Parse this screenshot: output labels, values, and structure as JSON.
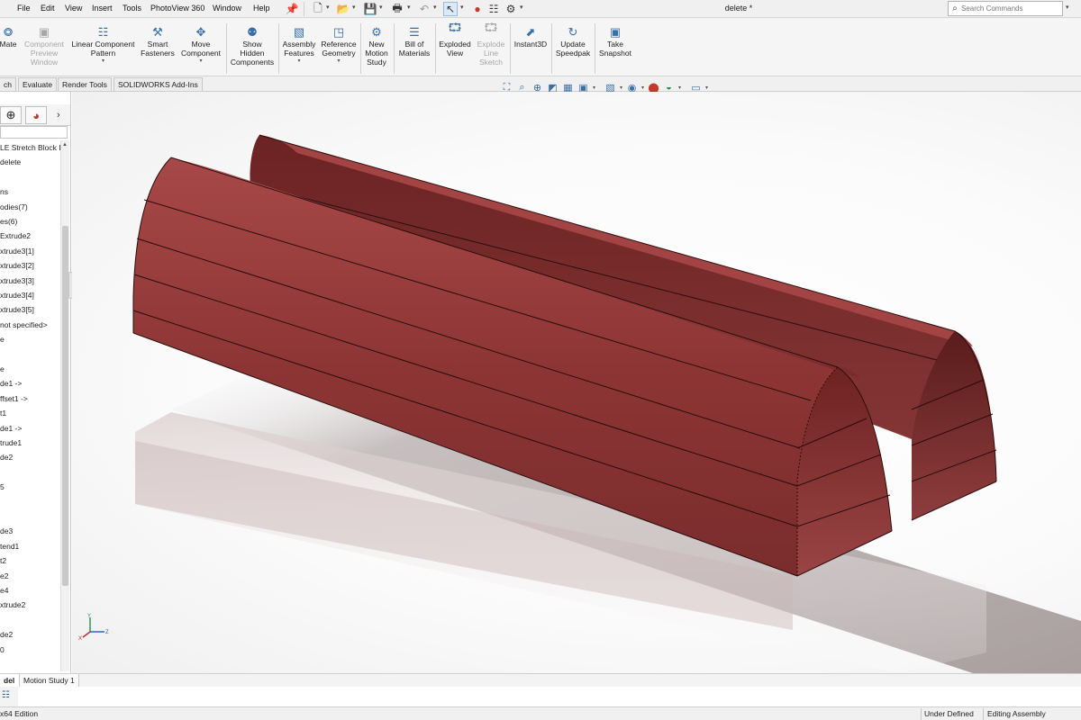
{
  "menu": {
    "items": [
      "File",
      "Edit",
      "View",
      "Insert",
      "Tools",
      "PhotoView 360",
      "Window",
      "Help"
    ],
    "pin_icon": "pin-icon"
  },
  "quick_access": {
    "icons": [
      "new-document-icon",
      "open-icon",
      "save-icon",
      "print-icon",
      "undo-icon",
      "select-arrow-icon",
      "rebuild-icon",
      "file-properties-icon",
      "options-icon"
    ]
  },
  "document": {
    "title": "delete *"
  },
  "search": {
    "placeholder": "Search Commands"
  },
  "command_manager": {
    "commands": [
      {
        "label": "Mate",
        "icon": "mate-icon",
        "enabled": true,
        "dropdown": false
      },
      {
        "label": "Component\nPreview\nWindow",
        "icon": "preview-window-icon",
        "enabled": false,
        "dropdown": false
      },
      {
        "label": "Linear Component\nPattern",
        "icon": "linear-pattern-icon",
        "enabled": true,
        "dropdown": true
      },
      {
        "label": "Smart\nFasteners",
        "icon": "smart-fasteners-icon",
        "enabled": true,
        "dropdown": false
      },
      {
        "label": "Move\nComponent",
        "icon": "move-component-icon",
        "enabled": true,
        "dropdown": true
      },
      {
        "label": "Show\nHidden\nComponents",
        "icon": "show-hidden-icon",
        "enabled": true,
        "dropdown": false
      },
      {
        "label": "Assembly\nFeatures",
        "icon": "assembly-features-icon",
        "enabled": true,
        "dropdown": true
      },
      {
        "label": "Reference\nGeometry",
        "icon": "reference-geometry-icon",
        "enabled": true,
        "dropdown": true
      },
      {
        "label": "New\nMotion\nStudy",
        "icon": "motion-study-icon",
        "enabled": true,
        "dropdown": false
      },
      {
        "label": "Bill of\nMaterials",
        "icon": "bill-of-materials-icon",
        "enabled": true,
        "dropdown": false
      },
      {
        "label": "Exploded\nView",
        "icon": "exploded-view-icon",
        "enabled": true,
        "dropdown": false
      },
      {
        "label": "Explode\nLine\nSketch",
        "icon": "explode-line-sketch-icon",
        "enabled": false,
        "dropdown": false
      },
      {
        "label": "Instant3D",
        "icon": "instant3d-icon",
        "enabled": true,
        "dropdown": false
      },
      {
        "label": "Update\nSpeedpak",
        "icon": "update-speedpak-icon",
        "enabled": true,
        "dropdown": false
      },
      {
        "label": "Take\nSnapshot",
        "icon": "take-snapshot-icon",
        "enabled": true,
        "dropdown": false
      }
    ]
  },
  "tabs": [
    "ch",
    "Evaluate",
    "Render Tools",
    "SOLIDWORKS Add-Ins"
  ],
  "view_toolbar": {
    "icons": [
      "zoom-to-fit-icon",
      "zoom-to-area-icon",
      "previous-view-icon",
      "section-view-icon",
      "dynamic-annotation-icon",
      "view-orientation-icon",
      "display-style-icon",
      "hide-show-items-icon",
      "edit-appearance-icon",
      "apply-scene-icon",
      "view-settings-icon"
    ]
  },
  "feature_tree": {
    "items": [
      "LE Stretch Block Ir",
      "delete",
      "",
      "ns",
      "odies(7)",
      "es(6)",
      "Extrude2",
      "xtrude3[1]",
      "xtrude3[2]",
      "xtrude3[3]",
      "xtrude3[4]",
      "xtrude3[5]",
      "not specified>",
      "e",
      "",
      "e",
      "de1 ->",
      "ffset1 ->",
      "t1",
      "de1 ->",
      "trude1",
      "de2",
      "",
      "5",
      "",
      "",
      "de3",
      "tend1",
      "t2",
      "e2",
      "e4",
      "xtrude2",
      "",
      "de2",
      "0"
    ]
  },
  "bottom_tabs": [
    "del",
    "Motion Study 1"
  ],
  "status": {
    "edition": "x64 Edition",
    "state": "Under Defined",
    "mode": "Editing Assembly"
  },
  "colors": {
    "part_body": "#7d2a2a",
    "part_highlight": "#a8484a",
    "part_shadow": "#4f1717",
    "edge_lines": "#2a0c0c",
    "ground_shadow": "#bdb2b2"
  }
}
